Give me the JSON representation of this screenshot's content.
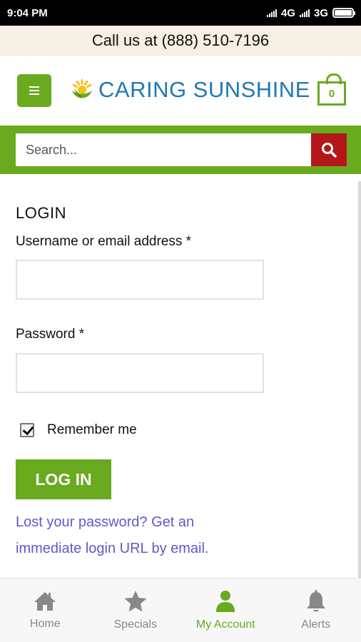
{
  "status_bar": {
    "time": "9:04 PM",
    "network_1": "4G",
    "network_2": "3G"
  },
  "callbar": {
    "text": "Call us at (888) 510-7196"
  },
  "header": {
    "logo_text": "CARING SUNSHINE",
    "cart_count": "0",
    "menu_icon": "hamburger-icon",
    "logo_icon": "sunshine-leaf-icon"
  },
  "search": {
    "placeholder": "Search...",
    "value": "",
    "button_icon": "search-icon"
  },
  "login": {
    "title": "LOGIN",
    "username_label": "Username or email address *",
    "username_value": "",
    "password_label": "Password *",
    "password_value": "",
    "remember_label": "Remember me",
    "remember_checked": true,
    "login_button": "LOG IN",
    "lost_password_link": "Lost your password? Get an immediate login URL by email."
  },
  "bottom_nav": {
    "items": [
      {
        "label": "Home",
        "icon": "home-icon",
        "active": false
      },
      {
        "label": "Specials",
        "icon": "star-icon",
        "active": false
      },
      {
        "label": "My Account",
        "icon": "user-icon",
        "active": true
      },
      {
        "label": "Alerts",
        "icon": "bell-icon",
        "active": false
      }
    ]
  },
  "colors": {
    "brand_green": "#6aaa1e",
    "brand_blue": "#1f78b4",
    "search_red": "#b3171c",
    "link_purple": "#6159c9",
    "callbar_bg": "#f5f0e3"
  }
}
